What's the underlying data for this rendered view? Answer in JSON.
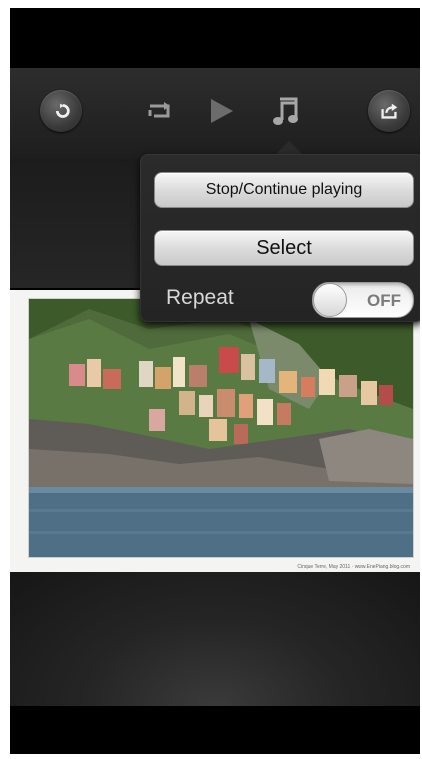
{
  "toolbar": {
    "back_icon": "back-arrow-icon",
    "repeat_icon": "repeat-icon",
    "play_icon": "play-icon",
    "music_icon": "music-note-icon",
    "share_icon": "share-icon"
  },
  "popover": {
    "stop_continue_label": "Stop/Continue playing",
    "select_label": "Select",
    "repeat_label": "Repeat",
    "repeat_toggle": "OFF"
  },
  "photo": {
    "caption": "Cinque Terre, May 2011 · www.EnePiang.blog.com"
  },
  "colors": {
    "toolbar_bg": "#2d2d2d",
    "popover_bg": "#2b2b2b",
    "button_fill": "#dcdcdc",
    "sea": "#4e6f86"
  }
}
